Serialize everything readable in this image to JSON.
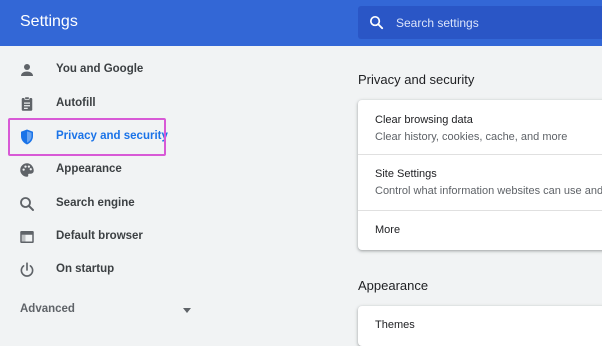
{
  "header": {
    "title": "Settings",
    "search_placeholder": "Search settings",
    "search_icon": "search-icon"
  },
  "sidebar": {
    "items": [
      {
        "label": "You and Google",
        "icon": "person-icon"
      },
      {
        "label": "Autofill",
        "icon": "clipboard-icon"
      },
      {
        "label": "Privacy and security",
        "icon": "shield-icon",
        "active": true
      },
      {
        "label": "Appearance",
        "icon": "palette-icon"
      },
      {
        "label": "Search engine",
        "icon": "search-icon"
      },
      {
        "label": "Default browser",
        "icon": "browser-icon"
      },
      {
        "label": "On startup",
        "icon": "power-icon"
      }
    ],
    "advanced_label": "Advanced"
  },
  "main": {
    "privacy_section": {
      "title": "Privacy and security",
      "rows": [
        {
          "title": "Clear browsing data",
          "subtitle": "Clear history, cookies, cache, and more"
        },
        {
          "title": "Site Settings",
          "subtitle": "Control what information websites can use and"
        },
        {
          "title": "More"
        }
      ]
    },
    "appearance_section": {
      "title": "Appearance",
      "rows": [
        {
          "title": "Themes"
        }
      ]
    }
  },
  "colors": {
    "header_bg": "#3367d6",
    "search_bg": "#2a56c6",
    "active_blue": "#1a73e8",
    "highlight": "#d859d6",
    "page_bg": "#f1f3f4"
  }
}
